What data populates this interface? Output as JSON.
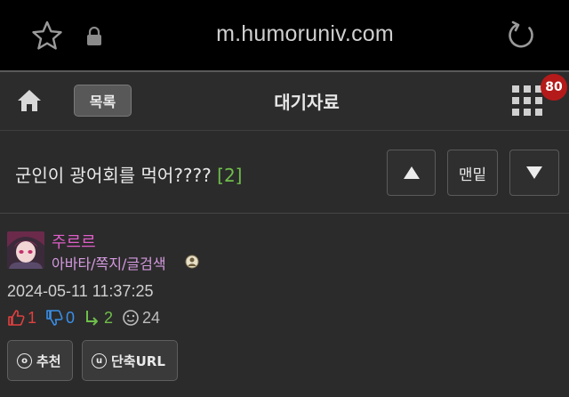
{
  "browser": {
    "url": "m.humoruniv.com",
    "star_icon": "star-icon",
    "lock_icon": "lock-icon",
    "reload_icon": "reload-icon"
  },
  "nav": {
    "list_label": "목록",
    "title": "대기자료",
    "badge_count": "80"
  },
  "post": {
    "title": "군인이 광어회를 먹어????",
    "comment_count": "[2]",
    "bottom_label": "맨밑"
  },
  "author": {
    "nickname": "주르르",
    "links": "아바타/쪽지/글검색",
    "date": "2024-05-11 11:37:25",
    "stats": {
      "up": "1",
      "down": "0",
      "reply": "2",
      "views": "24"
    }
  },
  "actions": {
    "recommend_label": "추천",
    "recommend_icon_letter": "o",
    "shorturl_label": "단축URL",
    "shorturl_icon_letter": "u"
  },
  "colors": {
    "nickname": "#e05ec9",
    "links": "#d59ae0",
    "comment_count": "#6fbf4b",
    "badge": "#b51a1a",
    "up": "#e04040",
    "down": "#3a8fe8",
    "reply": "#6fbf4b"
  }
}
